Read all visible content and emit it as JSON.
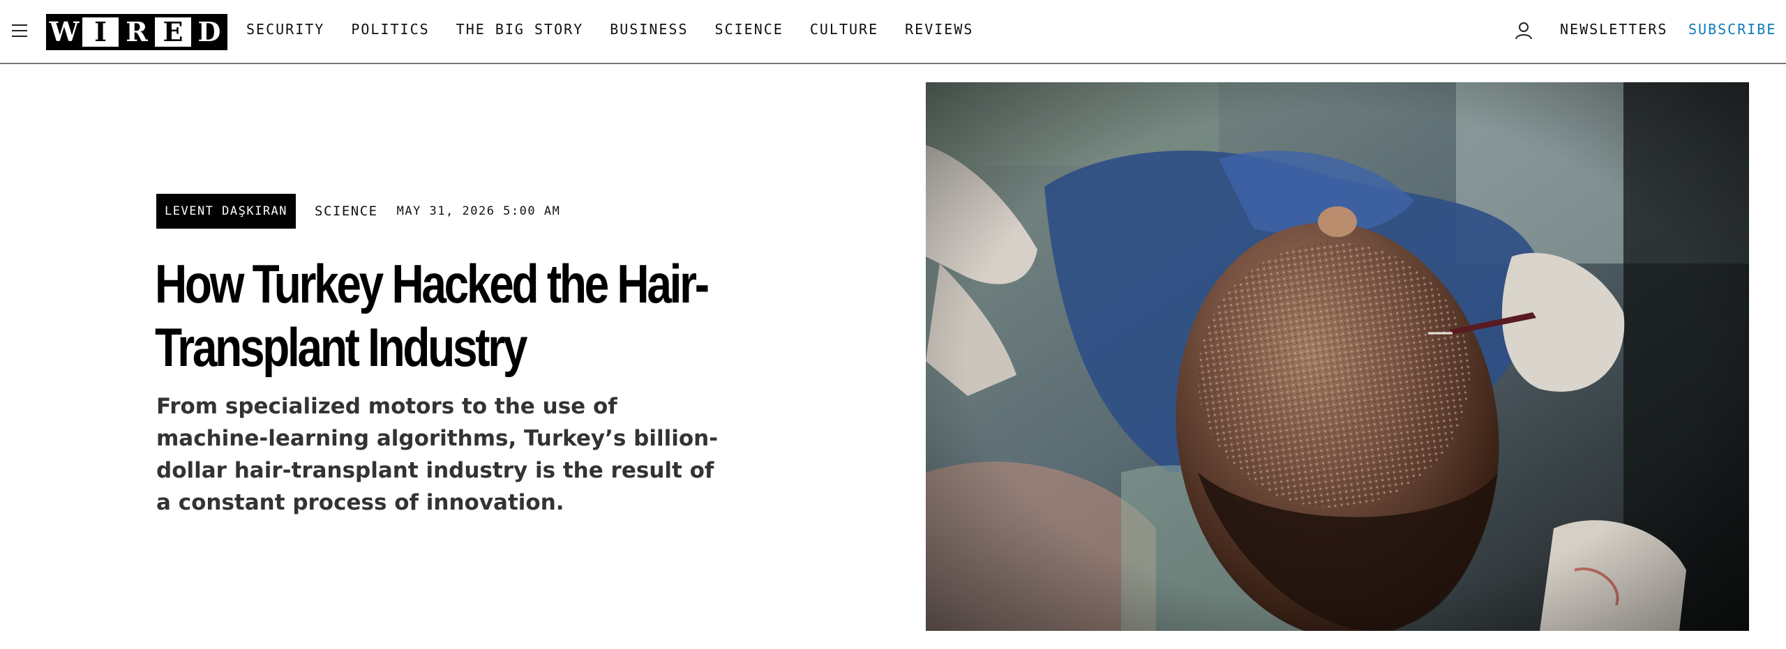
{
  "header": {
    "logo_letters": [
      "W",
      "I",
      "R",
      "E",
      "D"
    ],
    "nav_items": [
      "SECURITY",
      "POLITICS",
      "THE BIG STORY",
      "BUSINESS",
      "SCIENCE",
      "CULTURE",
      "REVIEWS"
    ],
    "newsletters_label": "NEWSLETTERS",
    "subscribe_label": "SUBSCRIBE",
    "subscribe_color": "#0f7ab8"
  },
  "article": {
    "author": "LEVENT DAŞKIRAN",
    "section": "SCIENCE",
    "date": "MAY 31, 2026 5:00 AM",
    "headline": "How Turkey Hacked the Hair-Transplant Industry",
    "dek": "From specialized motors to the use of machine-learning algorithms, Turkey’s billion-dollar hair-transplant industry is the result of a constant process of innovation."
  },
  "icons": {
    "menu": "hamburger-menu-icon",
    "account": "user-account-icon"
  }
}
